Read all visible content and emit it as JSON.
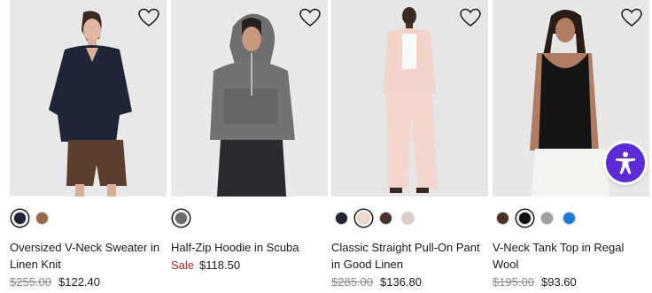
{
  "products": [
    {
      "name": "Oversized V-Neck Sweater in Linen Knit",
      "original_price": "$255.00",
      "price": "$122.40",
      "swatches": [
        "#1f2436",
        "#9a6b47"
      ],
      "selected_swatch": 0
    },
    {
      "name": "Half-Zip Hoodie in Scuba",
      "sale_label": "Sale",
      "price": "$118.50",
      "swatches": [
        "#6b6b6b"
      ],
      "selected_swatch": 0
    },
    {
      "name": "Classic Straight Pull-On Pant in Good Linen",
      "original_price": "$285.00",
      "price": "$136.80",
      "swatches": [
        "#1f2436",
        "#f4d6cd",
        "#4a3226",
        "#d9cfc7"
      ],
      "selected_swatch": 1
    },
    {
      "name": "V-Neck Tank Top in Regal Wool",
      "original_price": "$195.00",
      "price": "$93.60",
      "swatches": [
        "#4a3226",
        "#111111",
        "#9e9e9e",
        "#1e7bdc"
      ],
      "selected_swatch": 1
    }
  ],
  "icons": {
    "wishlist": "heart-outline-icon",
    "accessibility": "accessibility-person-icon"
  },
  "colors": {
    "sale": "#b3261e",
    "accessibility_button": "#5a2bd6"
  }
}
